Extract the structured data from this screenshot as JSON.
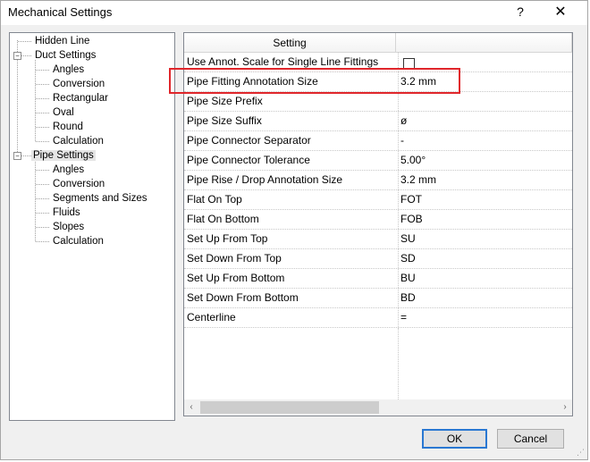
{
  "window": {
    "title": "Mechanical Settings",
    "help_label": "?",
    "close_label": "✕"
  },
  "tree": {
    "items": [
      {
        "label": "Hidden Line"
      },
      {
        "label": "Duct Settings"
      },
      {
        "label": "Angles"
      },
      {
        "label": "Conversion"
      },
      {
        "label": "Rectangular"
      },
      {
        "label": "Oval"
      },
      {
        "label": "Round"
      },
      {
        "label": "Calculation"
      },
      {
        "label": "Pipe Settings"
      },
      {
        "label": "Angles"
      },
      {
        "label": "Conversion"
      },
      {
        "label": "Segments and Sizes"
      },
      {
        "label": "Fluids"
      },
      {
        "label": "Slopes"
      },
      {
        "label": "Calculation"
      }
    ],
    "selected": "Pipe Settings",
    "expander_symbol": "−"
  },
  "grid": {
    "headers": {
      "setting": "Setting",
      "value": ""
    },
    "rows": [
      {
        "name": "Use Annot. Scale for Single Line Fittings",
        "value": "",
        "checkbox": true
      },
      {
        "name": "Pipe Fitting Annotation Size",
        "value": "3.2 mm"
      },
      {
        "name": "Pipe Size Prefix",
        "value": ""
      },
      {
        "name": "Pipe Size Suffix",
        "value": "ø"
      },
      {
        "name": "Pipe Connector Separator",
        "value": "-"
      },
      {
        "name": "Pipe Connector Tolerance",
        "value": "5.00°"
      },
      {
        "name": "Pipe Rise / Drop Annotation Size",
        "value": "3.2 mm"
      },
      {
        "name": "Flat On Top",
        "value": "FOT"
      },
      {
        "name": "Flat On Bottom",
        "value": "FOB"
      },
      {
        "name": "Set Up From Top",
        "value": "SU"
      },
      {
        "name": "Set Down From Top",
        "value": "SD"
      },
      {
        "name": "Set Up From Bottom",
        "value": "BU"
      },
      {
        "name": "Set Down From Bottom",
        "value": "BD"
      },
      {
        "name": "Centerline",
        "value": "="
      }
    ],
    "scroll_left": "‹",
    "scroll_right": "›"
  },
  "buttons": {
    "ok": "OK",
    "cancel": "Cancel"
  },
  "colors": {
    "highlight": "#e0262b",
    "default_button_border": "#2a78d2"
  }
}
